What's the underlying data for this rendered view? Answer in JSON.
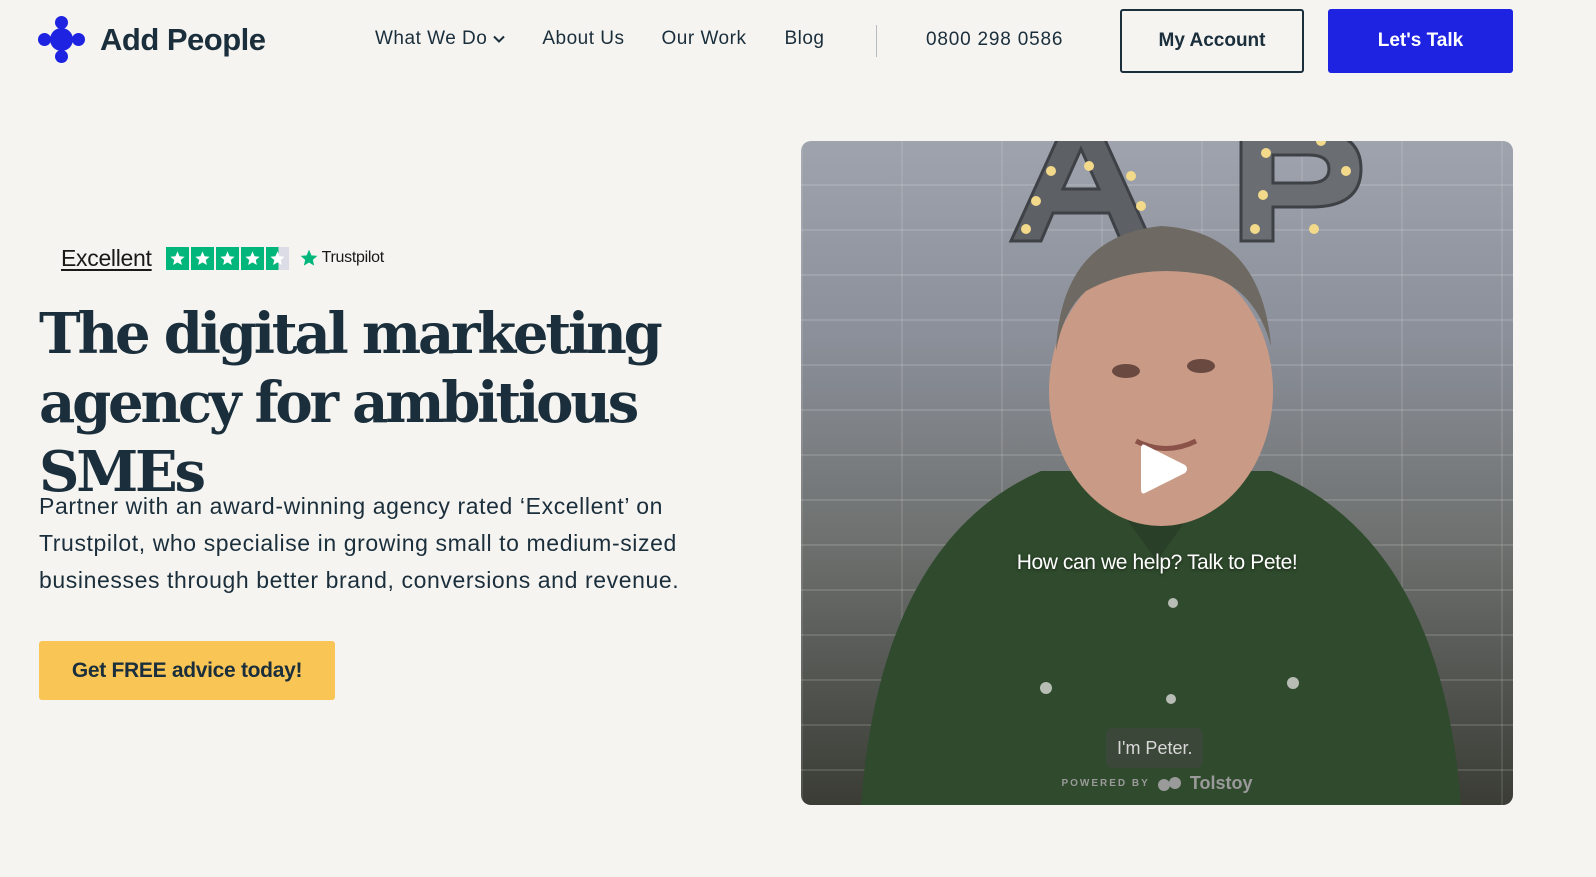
{
  "header": {
    "logo_text": "Add People",
    "nav": [
      {
        "label": "What We Do",
        "icon": "chevron-down-icon"
      },
      {
        "label": "About Us"
      },
      {
        "label": "Our Work"
      },
      {
        "label": "Blog"
      }
    ],
    "phone": "0800 298 0586",
    "account_label": "My Account",
    "talk_label": "Let's Talk"
  },
  "trustpilot": {
    "rating_text": "Excellent",
    "stars": 4.5,
    "brand": "Trustpilot"
  },
  "hero": {
    "headline_line1": "The digital marketing",
    "headline_line2": "agency for ambitious SMEs",
    "subtext": "Partner with an award-winning agency rated ‘Excellent’ on Trustpilot, who specialise in growing small to medium-sized businesses through better brand, conversions and revenue.",
    "cta_label": "Get FREE advice today!"
  },
  "video": {
    "caption": "How can we help? Talk to Pete!",
    "subtitle": "I'm Peter.",
    "powered_label": "POWERED BY",
    "powered_brand": "Tolstoy"
  },
  "colors": {
    "brand_blue": "#1d23e0",
    "cta_yellow": "#f9c656",
    "text_dark": "#1a2e3b",
    "trustpilot_green": "#00b67a",
    "background": "#f5f4f1"
  }
}
